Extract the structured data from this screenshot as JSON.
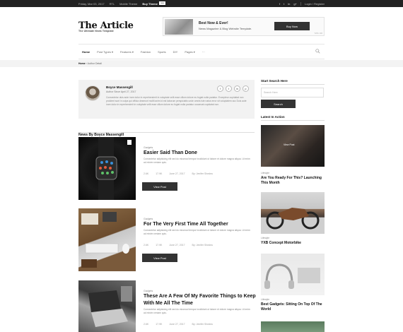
{
  "topbar": {
    "date": "Friday, Mar 03, 2017",
    "rtl": "RTL",
    "mobile": "Mobile Theme",
    "buy": "Buy Theme",
    "badge": "new",
    "social": [
      "f",
      "t",
      "in",
      "g+"
    ],
    "login": "Login / Register"
  },
  "header": {
    "logo": "The Article",
    "tagline": "The Ultimate News Template",
    "ad": {
      "title": "Best Now & Ever!",
      "subtitle": "News Magazine & Blog Website Template.",
      "button": "Buy Now",
      "note": "728 x 90"
    }
  },
  "nav": {
    "items": [
      "Home",
      "Post Types ▾",
      "Features ▾",
      "Fashion",
      "Sports",
      "DIY",
      "Pages ▾",
      "···"
    ]
  },
  "breadcrumb": {
    "home": "Home",
    "sep": "›",
    "current": "Author Detail"
  },
  "author": {
    "name": "Boyce Massengill",
    "since": "Author Since April 27, 2017",
    "bio": "Consectetur duis aute irure dolor in reprehenderit in voluptate velit esse cillum dolore eu fugiat nulla pariatur. Excepteur cupidatat non proident sunt in culpa qui officia deserunt mollit anim id est laborum perspiciatis unde omnis iste natus error sit voluptatem acc Duis aute irure dolor in reprehenderit in voluptate velit esse cillum dolore eu fugiat nulla pariatur occaecat cupidatat non.",
    "social": [
      "f",
      "t",
      "in",
      "p"
    ]
  },
  "section": {
    "heading": "News By Boyce Massengill"
  },
  "posts": [
    {
      "category": "Gadgets",
      "title": "Easier Said Than Done",
      "excerpt": "Consectetur adipisicing elit sed do eiusmod tempor incididunt ut labore et dolore magna aliqua. Ut enim ad minim veniam quis.",
      "likes": "2.6K",
      "views": "17.9K",
      "date": "June 27, 2017",
      "author": "By: Jenifer Shedeu",
      "button": "View Post"
    },
    {
      "category": "Gadgets",
      "title": "For The Very First Time All Together",
      "excerpt": "Consectetur adipisicing elit sed do eiusmod tempor incididunt ut labore et dolore magna aliqua. Ut enim ad minim veniam quis.",
      "likes": "2.6K",
      "views": "17.9K",
      "date": "June 27, 2017",
      "author": "By: Jenifer Shedeu",
      "button": "View Post"
    },
    {
      "category": "Gadgets",
      "title": "These Are A Few Of My Favorite Things to Keep With Me All The Time",
      "excerpt": "Consectetur adipisicing elit sed do eiusmod tempor incididunt ut labore et dolore magna aliqua. Ut enim ad minim veniam quis.",
      "likes": "2.6K",
      "views": "17.9K",
      "date": "June 27, 2017",
      "author": "By: Jenifer Shedeu",
      "button": "View Post"
    }
  ],
  "sidebar": {
    "search_heading": "Start Search Here",
    "search_placeholder": "Search Here",
    "search_button": "Search",
    "latest_heading": "Latest In Action",
    "cards": [
      {
        "label": "",
        "title": "",
        "overlay": "View Post"
      },
      {
        "label": "Lifestyle",
        "title": "Are You Ready For This? Launching This Month"
      },
      {
        "label": "Lifestyle",
        "title": "YXB Concept Motorbike"
      },
      {
        "label": "Lifestyle",
        "title": "Best Gadgets: Sitting On Top Of The World"
      }
    ]
  }
}
